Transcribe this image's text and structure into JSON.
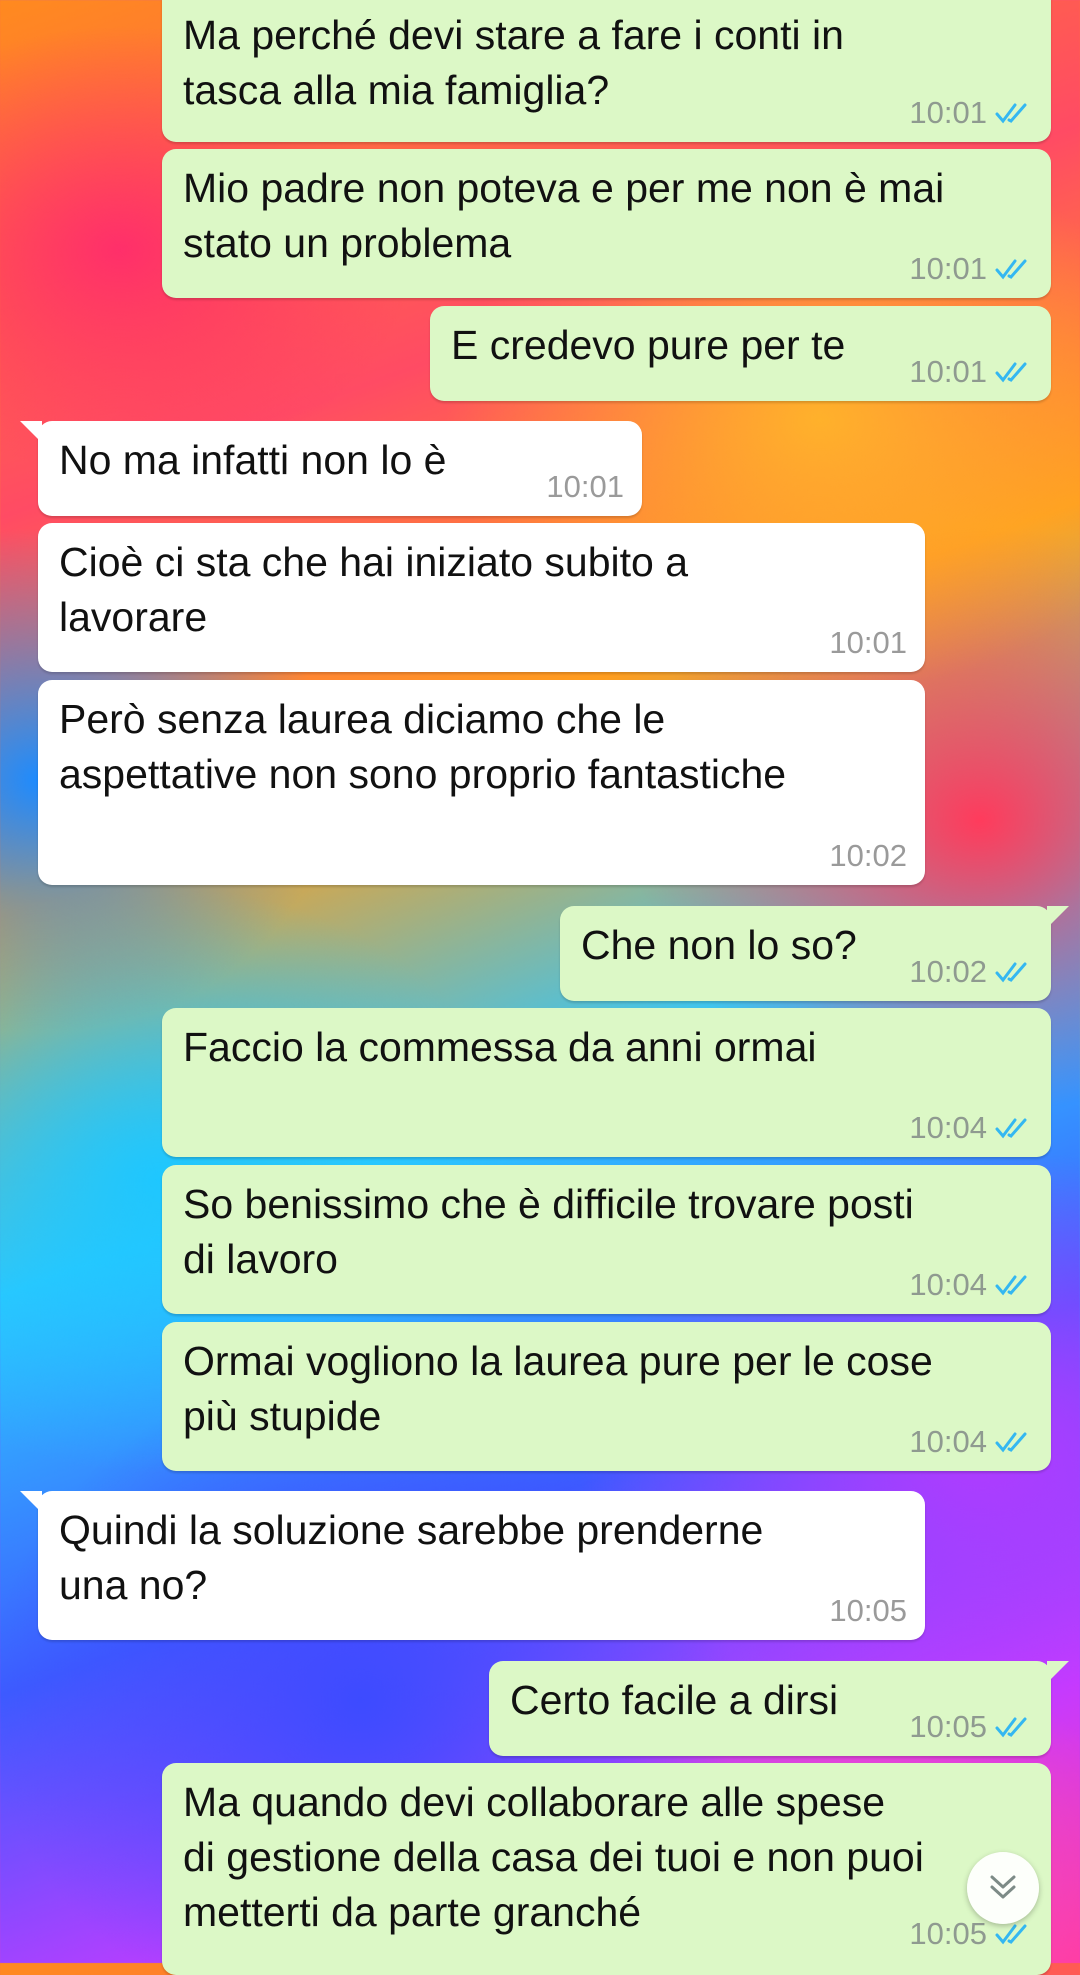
{
  "colors": {
    "outgoing_bubble": "#dcf8c6",
    "incoming_bubble": "#ffffff",
    "read_ticks": "#34b7f1",
    "time_text": "#8f9a90"
  },
  "messages": [
    {
      "dir": "out",
      "text": "Ma perché devi stare a fare i conti in\ntasca alla mia famiglia?",
      "time": "10:01",
      "status": "read-ticks-icon"
    },
    {
      "dir": "out",
      "text": "Mio padre non poteva e per me non è mai\nstato un problema",
      "time": "10:01",
      "status": "read-ticks-icon"
    },
    {
      "dir": "out",
      "text": "E credevo pure per te",
      "time": "10:01",
      "status": "read-ticks-icon"
    },
    {
      "dir": "in",
      "text": "No ma infatti non lo è",
      "time": "10:01"
    },
    {
      "dir": "in",
      "text": "Cioè ci sta che hai iniziato subito a\nlavorare",
      "time": "10:01"
    },
    {
      "dir": "in",
      "text": "Però senza laurea diciamo che le\naspettative non sono proprio fantastiche",
      "time": "10:02"
    },
    {
      "dir": "out",
      "text": "Che non lo so?",
      "time": "10:02",
      "status": "read-ticks-icon"
    },
    {
      "dir": "out",
      "text": "Faccio la commessa da anni ormai",
      "time": "10:04",
      "status": "read-ticks-icon"
    },
    {
      "dir": "out",
      "text": "So benissimo che è difficile trovare posti\ndi lavoro",
      "time": "10:04",
      "status": "read-ticks-icon"
    },
    {
      "dir": "out",
      "text": "Ormai vogliono la laurea pure per le cose\npiù stupide",
      "time": "10:04",
      "status": "read-ticks-icon"
    },
    {
      "dir": "in",
      "text": "Quindi la soluzione sarebbe prenderne\nuna no?",
      "time": "10:05"
    },
    {
      "dir": "out",
      "text": "Certo facile a dirsi",
      "time": "10:05",
      "status": "read-ticks-icon"
    },
    {
      "dir": "out",
      "text": "Ma quando devi collaborare alle spese\ndi gestione della casa dei tuoi e non puoi\nmetterti da parte granché",
      "time": "10:05",
      "status": "read-ticks-icon"
    }
  ],
  "scroll_button": {
    "icon": "double-chevron-down-icon"
  }
}
